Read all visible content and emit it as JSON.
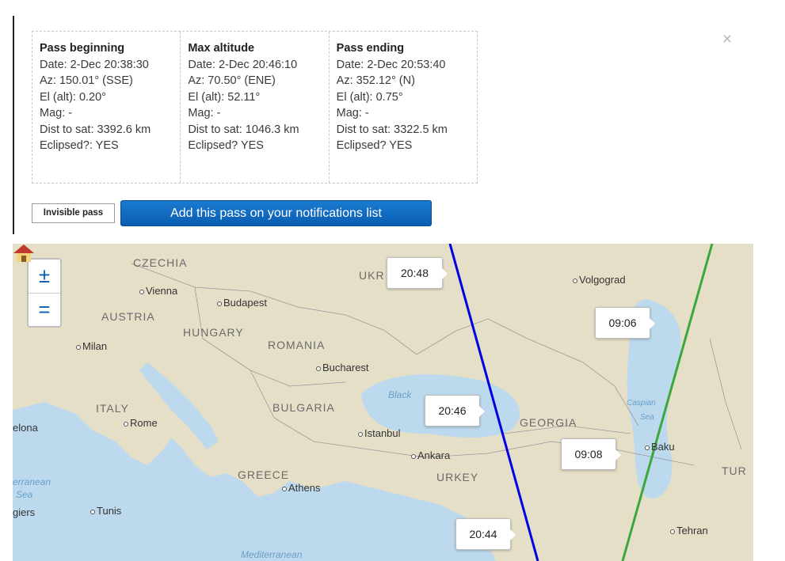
{
  "close_label": "×",
  "pass": {
    "begin": {
      "heading": "Pass beginning",
      "date": "Date: 2-Dec 20:38:30",
      "az": "Az: 150.01° (SSE)",
      "el": "El (alt): 0.20°",
      "mag": "Mag: -",
      "dist": "Dist to sat: 3392.6 km",
      "eclipsed": "Eclipsed?: YES"
    },
    "max": {
      "heading": "Max altitude",
      "date": "Date: 2-Dec 20:46:10",
      "az": "Az: 70.50° (ENE)",
      "el": "El (alt): 52.11°",
      "mag": "Mag: -",
      "dist": "Dist to sat: 1046.3 km",
      "eclipsed": "Eclipsed? YES"
    },
    "end": {
      "heading": "Pass ending",
      "date": "Date: 2-Dec 20:53:40",
      "az": "Az: 352.12° (N)",
      "el": "El (alt): 0.75°",
      "mag": "Mag: -",
      "dist": "Dist to sat: 3322.5 km",
      "eclipsed": "Eclipsed? YES"
    }
  },
  "invisible_label": "Invisible pass",
  "add_button_label": "Add this pass on your notifications list",
  "map": {
    "zoom_in": "±",
    "zoom_out": "=",
    "countries": {
      "czechia": "CZECHIA",
      "austria": "AUSTRIA",
      "hungary": "HUNGARY",
      "romania": "ROMANIA",
      "ukraine": "UKR",
      "italy": "ITALY",
      "bulgaria": "BULGARIA",
      "greece": "GREECE",
      "turkey": "URKEY",
      "georgia": "GEORGIA",
      "iran": "TUR"
    },
    "cities": {
      "vienna": "Vienna",
      "budapest": "Budapest",
      "milan": "Milan",
      "bucharest": "Bucharest",
      "rome": "Rome",
      "istanbul": "Istanbul",
      "ankara": "Ankara",
      "athens": "Athens",
      "tunis": "Tunis",
      "volgograd": "Volgograd",
      "baku": "Baku",
      "tehran": "Tehran",
      "barcelona": "elona",
      "algiers": "giers"
    },
    "seas": {
      "black": "Black",
      "caspian": "Caspian",
      "caspian2": "Sea",
      "mediterranean": "erranean",
      "mediterranean2": "Sea",
      "mediterranean3": "Mediterranean"
    },
    "time_labels": {
      "t2048": "20:48",
      "t2046": "20:46",
      "t2044": "20:44",
      "t0906": "09:06",
      "t0908": "09:08"
    },
    "colors": {
      "track_current": "#0000e0",
      "track_next": "#3aa83a",
      "water": "#bcd9ee",
      "land": "#e6dfc8"
    }
  }
}
